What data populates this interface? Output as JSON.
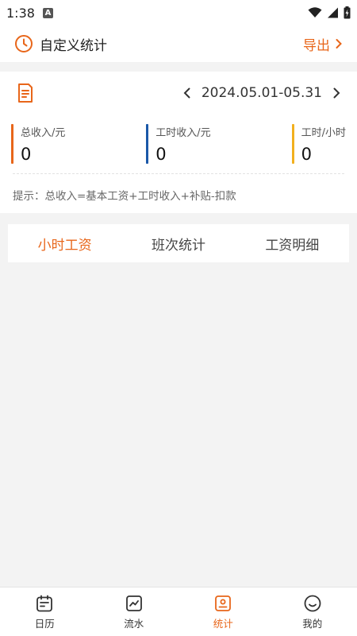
{
  "status_bar": {
    "time": "1:38",
    "notification_letter": "A"
  },
  "header": {
    "title": "自定义统计",
    "export_label": "导出"
  },
  "summary": {
    "date_range": "2024.05.01-05.31",
    "stats": [
      {
        "label": "总收入/元",
        "value": "0",
        "color": "#e8661a"
      },
      {
        "label": "工时收入/元",
        "value": "0",
        "color": "#1a58a8"
      },
      {
        "label": "工时/小时",
        "value": "0",
        "color": "#f2b01e"
      }
    ],
    "hint": "提示：总收入=基本工资+工时收入+补贴-扣款"
  },
  "tabs": [
    {
      "label": "小时工资",
      "active": true
    },
    {
      "label": "班次统计",
      "active": false
    },
    {
      "label": "工资明细",
      "active": false
    }
  ],
  "bottom_nav": [
    {
      "label": "日历",
      "icon": "calendar-icon",
      "active": false
    },
    {
      "label": "流水",
      "icon": "trend-chart-icon",
      "active": false
    },
    {
      "label": "统计",
      "icon": "stats-card-icon",
      "active": true
    },
    {
      "label": "我的",
      "icon": "smiley-icon",
      "active": false
    }
  ],
  "colors": {
    "accent": "#e8661a",
    "blue": "#1a58a8",
    "yellow": "#f2b01e",
    "background": "#f3f3f3"
  }
}
